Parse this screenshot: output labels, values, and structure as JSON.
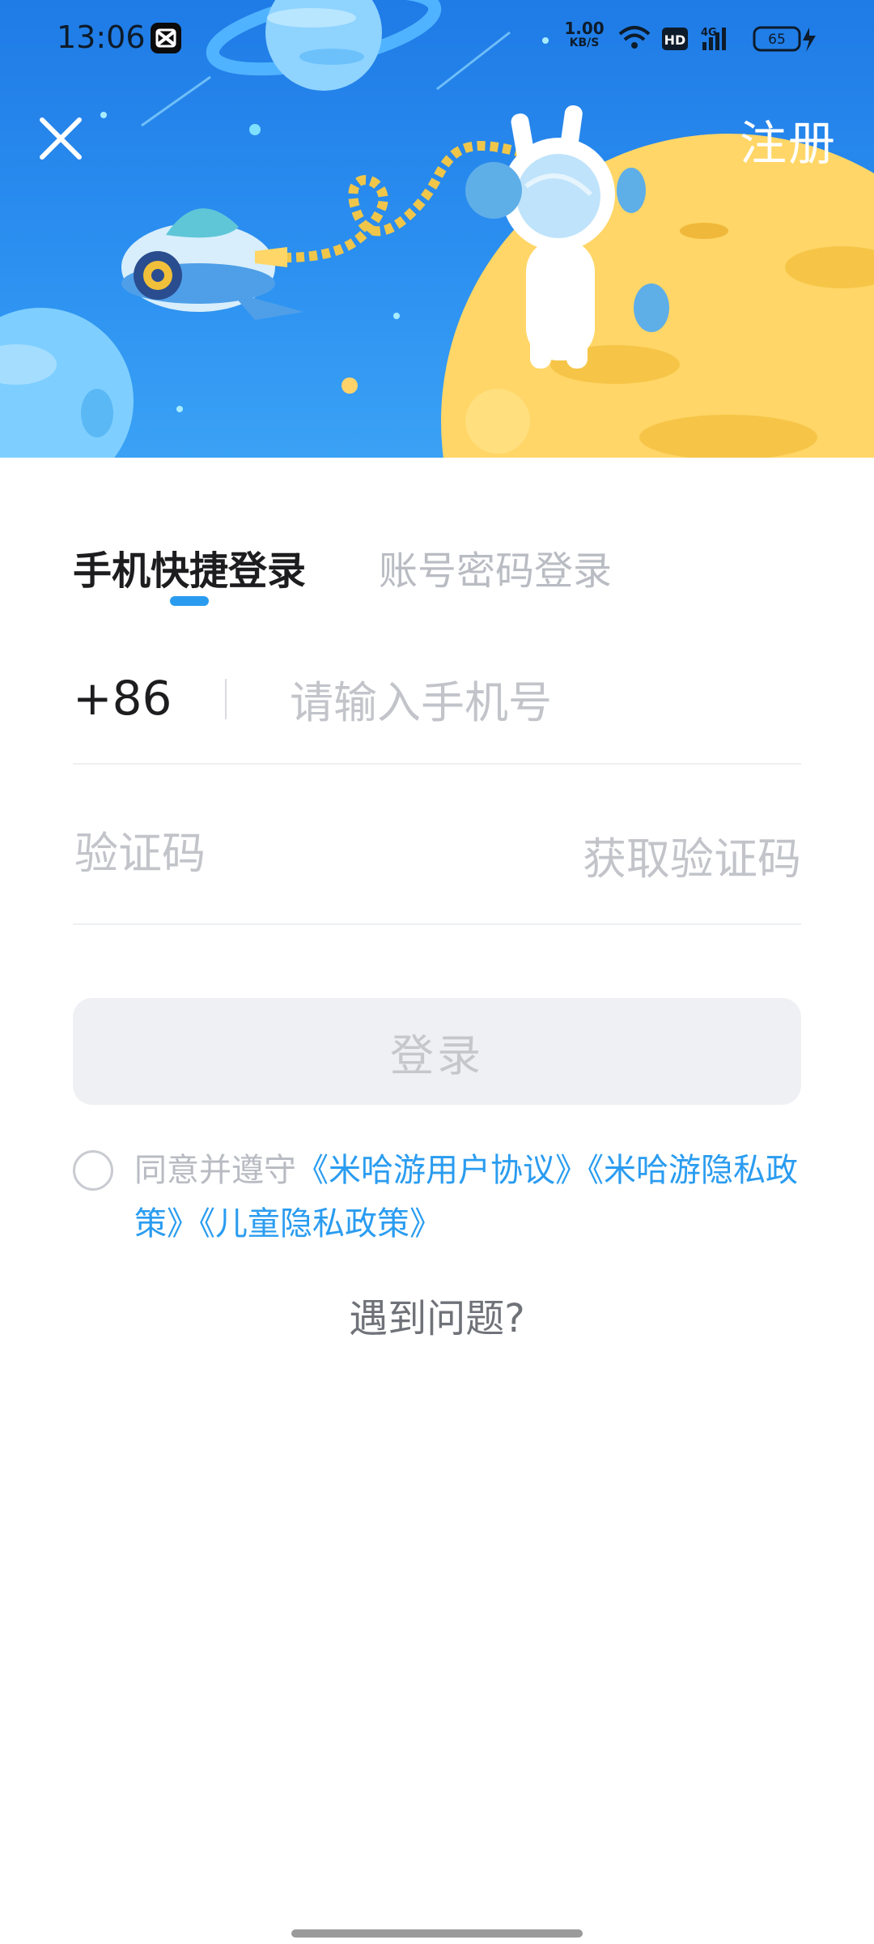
{
  "status_bar": {
    "time": "13:06",
    "network_speed": "1.00",
    "network_unit": "KB/S",
    "hd_badge": "HD",
    "signal_label": "4G",
    "battery": "65"
  },
  "header": {
    "register_label": "注册",
    "close_icon": "close-icon"
  },
  "tabs": [
    {
      "label": "手机快捷登录",
      "active": true
    },
    {
      "label": "账号密码登录",
      "active": false
    }
  ],
  "phone": {
    "country_code": "+86",
    "placeholder": "请输入手机号",
    "value": ""
  },
  "code": {
    "placeholder": "验证码",
    "value": "",
    "get_code_label": "获取验证码"
  },
  "login_button": "登录",
  "agreement": {
    "prefix": "同意并遵守",
    "link_1": "《米哈游用户协议》",
    "link_2": "《米哈游隐私政策》",
    "link_3": "《儿童隐私政策》",
    "checked": false
  },
  "help_link": "遇到问题?",
  "colors": {
    "accent": "#2a9cf0",
    "banner_top": "#1f7be6",
    "disabled_button": "#eff0f3",
    "placeholder": "#c2c4ca"
  }
}
